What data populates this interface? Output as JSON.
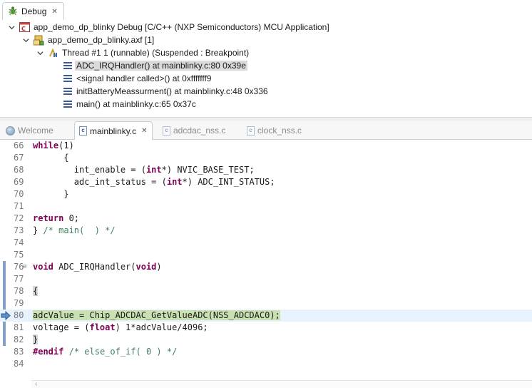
{
  "debug_view": {
    "tab_label": "Debug",
    "launch": "app_demo_dp_blinky Debug [C/C++ (NXP Semiconductors) MCU Application]",
    "binary": "app_demo_dp_blinky.axf [1]",
    "thread": "Thread #1 1 (runnable) (Suspended : Breakpoint)",
    "frames": [
      "ADC_IRQHandler() at mainblinky.c:80 0x39e",
      "<signal handler called>() at 0xfffffff9",
      "initBatteryMeassurment() at mainblinky.c:48 0x336",
      "main() at mainblinky.c:65 0x37c"
    ]
  },
  "editor": {
    "tabs": {
      "welcome": "Welcome",
      "mainblinky": "mainblinky.c",
      "adcdac": "adcdac_nss.c",
      "clock": "clock_nss.c"
    },
    "lines": [
      {
        "num": "66",
        "segs": [
          {
            "t": "while",
            "c": "kw"
          },
          {
            "t": "(1)"
          }
        ]
      },
      {
        "num": "67",
        "segs": [
          {
            "t": "      {"
          }
        ]
      },
      {
        "num": "68",
        "segs": [
          {
            "t": "        int_enable = ("
          },
          {
            "t": "int",
            "c": "kw"
          },
          {
            "t": "*) NVIC_BASE_TEST;"
          }
        ]
      },
      {
        "num": "69",
        "segs": [
          {
            "t": "        adc_int_status = ("
          },
          {
            "t": "int",
            "c": "kw"
          },
          {
            "t": "*) ADC_INT_STATUS;"
          }
        ]
      },
      {
        "num": "70",
        "segs": [
          {
            "t": "      }"
          }
        ]
      },
      {
        "num": "71",
        "segs": []
      },
      {
        "num": "72",
        "segs": [
          {
            "t": "return",
            "c": "kw"
          },
          {
            "t": " 0;"
          }
        ]
      },
      {
        "num": "73",
        "segs": [
          {
            "t": "} "
          },
          {
            "t": "/* main(  ) */",
            "c": "cmt"
          }
        ]
      },
      {
        "num": "74",
        "segs": []
      },
      {
        "num": "75",
        "segs": []
      },
      {
        "num": "76",
        "segs": [
          {
            "t": "void",
            "c": "kw"
          },
          {
            "t": " ADC_IRQHandler("
          },
          {
            "t": "void",
            "c": "kw"
          },
          {
            "t": ")"
          }
        ]
      },
      {
        "num": "77",
        "segs": []
      },
      {
        "num": "78",
        "segs": [
          {
            "t": "{",
            "c": "hl-gray"
          }
        ]
      },
      {
        "num": "79",
        "segs": []
      },
      {
        "num": "80",
        "segs": [
          {
            "t": "adcValue = Chip_ADCDAC_GetValueADC(NSS_ADCDAC0);",
            "c": "hl-green"
          }
        ]
      },
      {
        "num": "81",
        "segs": [
          {
            "t": "voltage = ("
          },
          {
            "t": "float",
            "c": "kw"
          },
          {
            "t": ") 1*adcValue/4096;"
          }
        ]
      },
      {
        "num": "82",
        "segs": [
          {
            "t": "}",
            "c": "hl-gray"
          }
        ]
      },
      {
        "num": "83",
        "segs": [
          {
            "t": "#endif",
            "c": "kw"
          },
          {
            "t": " "
          },
          {
            "t": "/* else_of_if( 0 ) */",
            "c": "cmt"
          }
        ]
      },
      {
        "num": "84",
        "segs": []
      }
    ]
  },
  "colors": {
    "keyword": "#7f0055",
    "comment": "#3f7f5f",
    "current_line": "#e8f2fe",
    "line_highlight": "#c9e0b0"
  }
}
